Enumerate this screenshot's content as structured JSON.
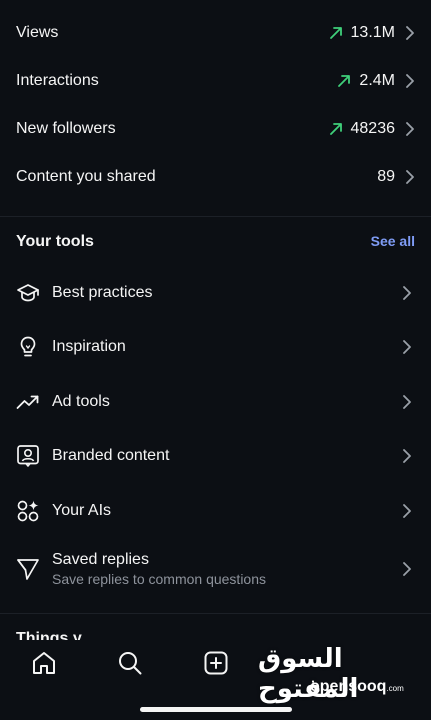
{
  "stats": [
    {
      "label": "Views",
      "value": "13.1M",
      "trend": "up"
    },
    {
      "label": "Interactions",
      "value": "2.4M",
      "trend": "up"
    },
    {
      "label": "New followers",
      "value": "48236",
      "trend": "up"
    },
    {
      "label": "Content you shared",
      "value": "89",
      "trend": ""
    }
  ],
  "tools": {
    "title": "Your tools",
    "see_all": "See all",
    "items": [
      {
        "label": "Best practices",
        "icon": "graduation-cap-icon"
      },
      {
        "label": "Inspiration",
        "icon": "lightbulb-icon"
      },
      {
        "label": "Ad tools",
        "icon": "trending-up-icon"
      },
      {
        "label": "Branded content",
        "icon": "branded-content-icon"
      },
      {
        "label": "Your AIs",
        "icon": "ai-sparkle-icon"
      },
      {
        "label": "Saved replies",
        "sublabel": "Save replies to common questions",
        "icon": "send-icon"
      }
    ]
  },
  "next_section_partial": "Things y",
  "bottom_nav": [
    "home-icon",
    "search-icon",
    "create-icon"
  ],
  "watermark": {
    "arabic": "السوق المفتوح",
    "latin": "opensooq",
    "suffix": ".com"
  },
  "colors": {
    "background": "#0c0f14",
    "trend_up": "#3fd07a",
    "link": "#7f9cf5",
    "muted": "#8e939c"
  }
}
